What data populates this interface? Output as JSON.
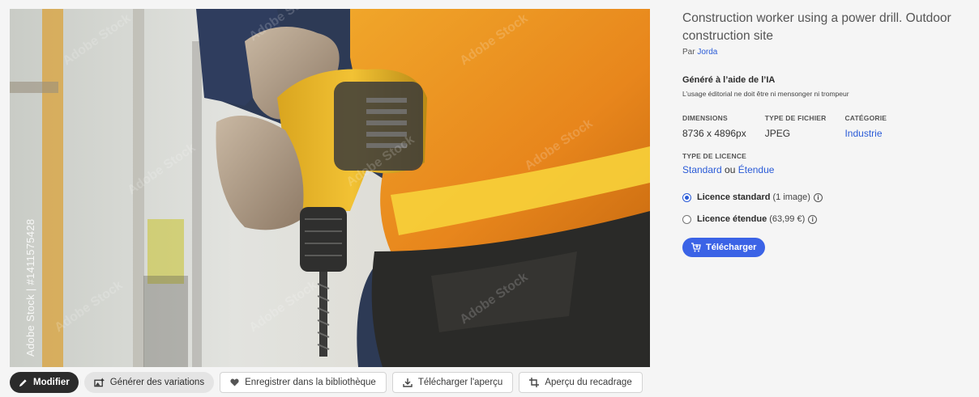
{
  "photo": {
    "alt_icon": "stock-photo-construction-drill",
    "watermark_text": "Adobe Stock",
    "vertical_id": "Adobe Stock | #1411575428"
  },
  "toolbar": {
    "modify_label": "Modifier",
    "variations_label": "Générer des variations",
    "save_library_label": "Enregistrer dans la bibliothèque",
    "download_preview_label": "Télécharger l'aperçu",
    "crop_preview_label": "Aperçu du recadrage"
  },
  "panel": {
    "title": "Construction worker using a power drill. Outdoor construction site",
    "by_prefix": "Par",
    "author": "Jorda",
    "ai_title": "Généré à l’aide de l’IA",
    "ai_note": "L’usage éditorial ne doit être ni mensonger ni trompeur",
    "meta": {
      "dimensions_key": "DIMENSIONS",
      "dimensions_value": "8736 x 4896px",
      "filetype_key": "TYPE DE FICHIER",
      "filetype_value": "JPEG",
      "category_key": "CATÉGORIE",
      "category_value": "Industrie"
    },
    "license_type_key": "TYPE DE LICENCE",
    "license_standard": "Standard",
    "license_or": "ou",
    "license_extended": "Étendue",
    "radio_standard_label": "Licence standard",
    "radio_standard_extra": "(1 image)",
    "radio_extended_label": "Licence étendue",
    "radio_extended_extra": "(63,99 €)",
    "download_label": "Télécharger",
    "selected_license": "standard",
    "accent_color": "#3b63e6"
  }
}
